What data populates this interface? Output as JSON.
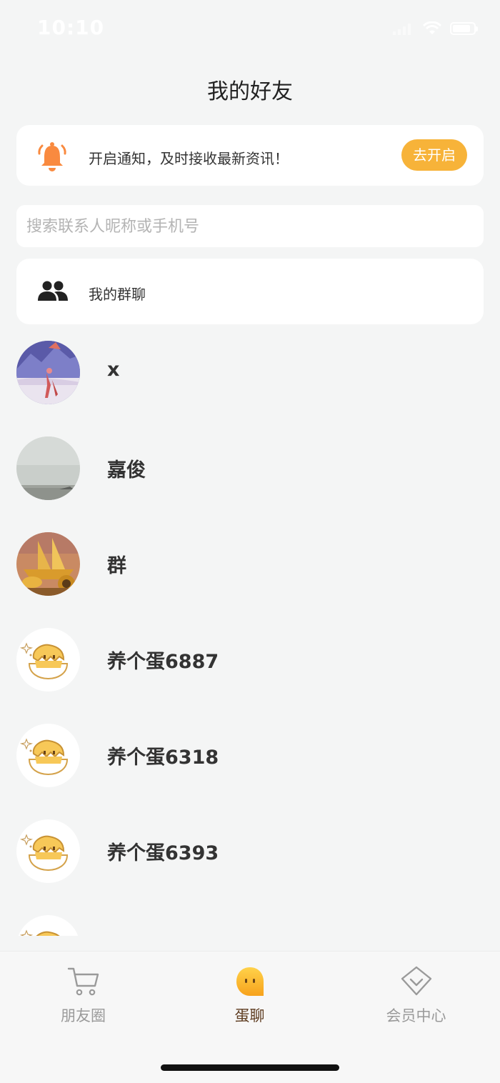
{
  "status_bar": {
    "time": "10:10"
  },
  "header": {
    "title": "我的好友"
  },
  "notice": {
    "text": "开启通知，及时接收最新资讯！",
    "button_label": "去开启",
    "accent": "#f7b339"
  },
  "search": {
    "placeholder": "搜索联系人昵称或手机号",
    "value": ""
  },
  "group_chat": {
    "label": "我的群聊"
  },
  "contacts": [
    {
      "name": "x",
      "avatar": "snow-scene-avatar"
    },
    {
      "name": "嘉俊",
      "avatar": "sky-landscape-avatar"
    },
    {
      "name": "群",
      "avatar": "golden-ship-avatar"
    },
    {
      "name": "养个蛋6887",
      "avatar": "egg-avatar"
    },
    {
      "name": "养个蛋6318",
      "avatar": "egg-avatar"
    },
    {
      "name": "养个蛋6393",
      "avatar": "egg-avatar"
    },
    {
      "name": "",
      "avatar": "egg-avatar"
    }
  ],
  "tabbar": {
    "tabs": [
      {
        "label": "朋友圈",
        "icon": "cart-icon",
        "active": false
      },
      {
        "label": "蛋聊",
        "icon": "egg-chat-icon",
        "active": true
      },
      {
        "label": "会员中心",
        "icon": "diamond-icon",
        "active": false
      }
    ],
    "active_color": "#5c3a1e",
    "inactive_color": "#9a9a9a"
  }
}
